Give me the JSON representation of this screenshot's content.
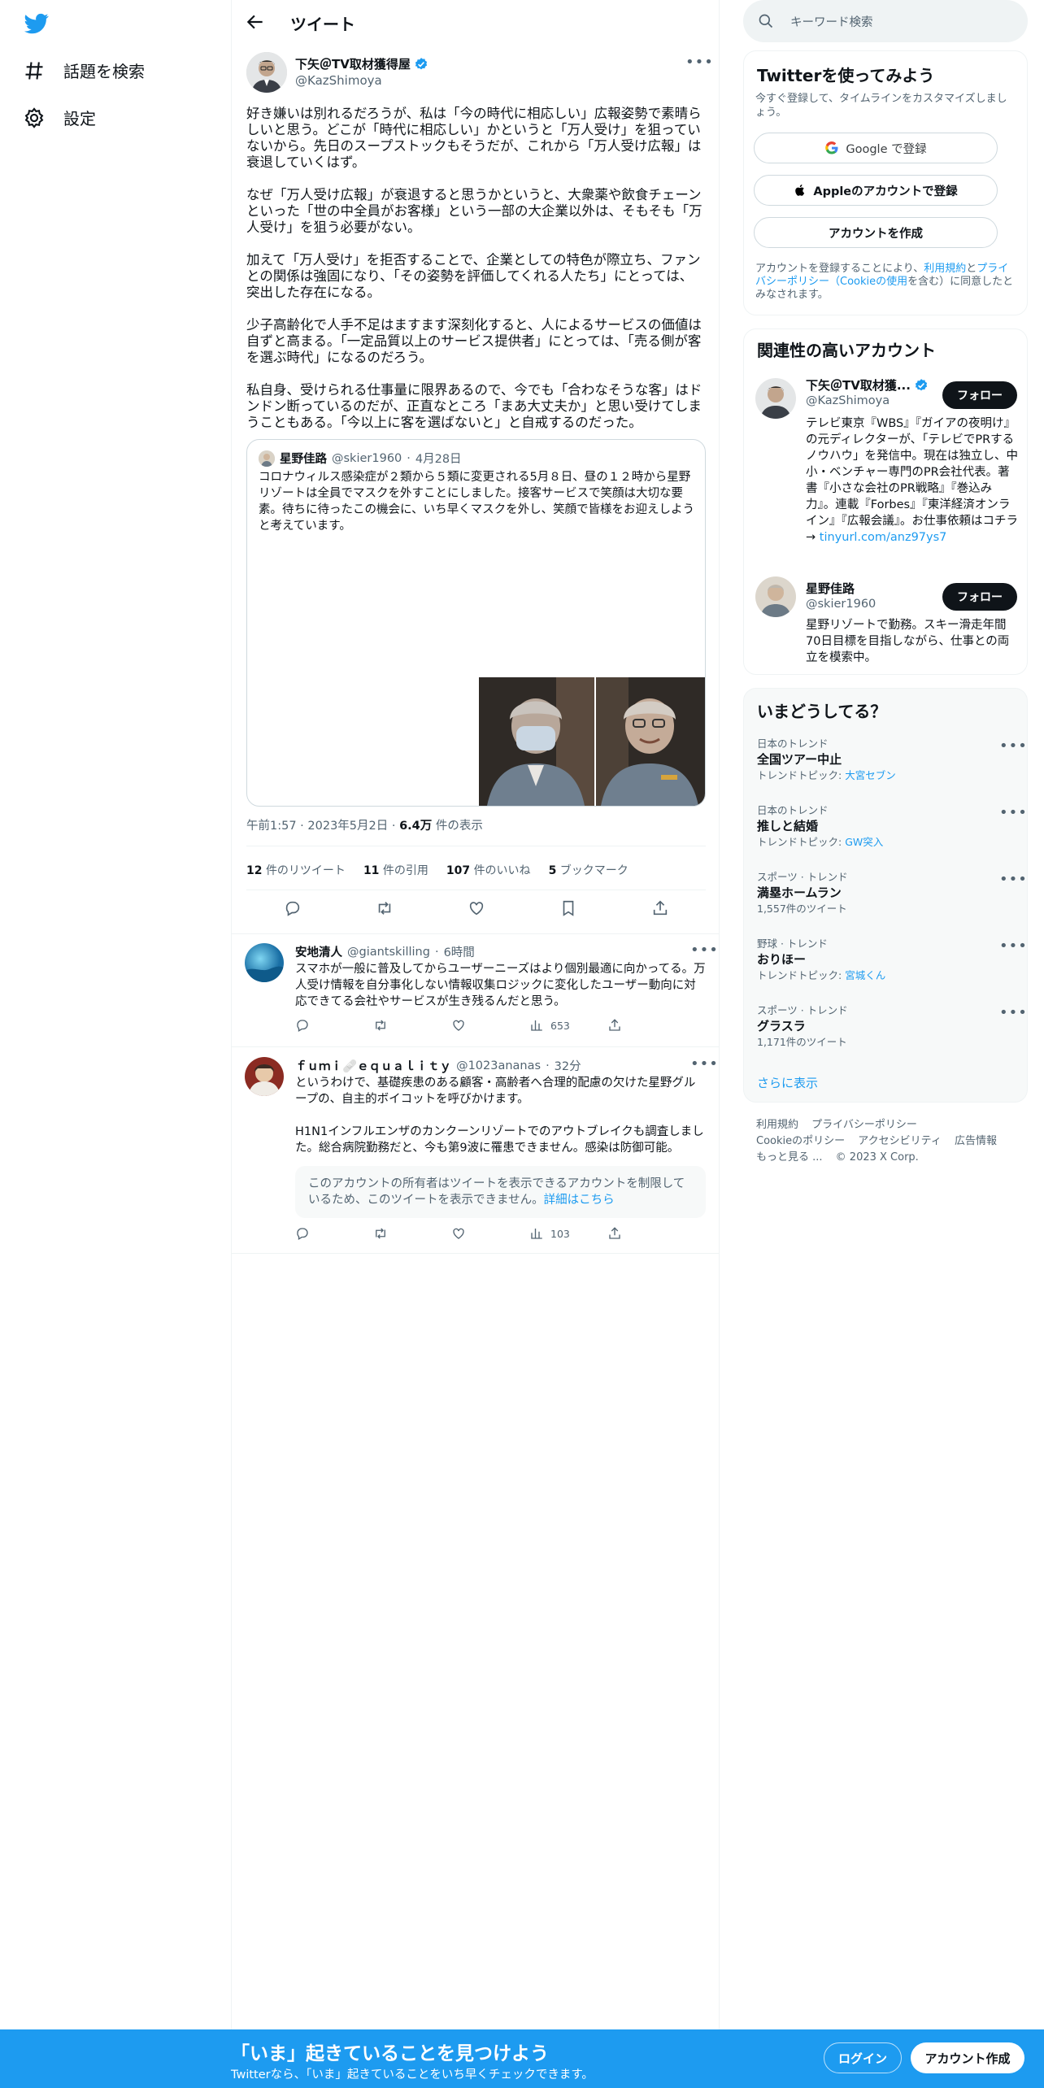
{
  "nav": {
    "items": [
      {
        "label": "話題を検索",
        "icon": "hashtag-icon"
      },
      {
        "label": "設定",
        "icon": "gear-icon"
      }
    ]
  },
  "header": {
    "title": "ツイート"
  },
  "tweet": {
    "author_name": "下矢＠TV取材獲得屋",
    "author_handle": "@KazShimoya",
    "paragraphs": [
      "好き嫌いは別れるだろうが、私は「今の時代に相応しい」広報姿勢で素晴らしいと思う。どこが「時代に相応しい」かというと「万人受け」を狙っていないから。先日のスープストックもそうだが、これから「万人受け広報」は衰退していくはず。",
      "なぜ「万人受け広報」が衰退すると思うかというと、大衆薬や飲食チェーンといった「世の中全員がお客様」という一部の大企業以外は、そもそも「万人受け」を狙う必要がない。",
      "加えて「万人受け」を拒否することで、企業としての特色が際立ち、ファンとの関係は強固になり、「その姿勢を評価してくれる人たち」にとっては、突出した存在になる。",
      "少子高齢化で人手不足はますます深刻化すると、人によるサービスの価値は自ずと高まる。「一定品質以上のサービス提供者」にとっては、「売る側が客を選ぶ時代」になるのだろう。",
      "私自身、受けられる仕事量に限界あるので、今でも「合わなそうな客」はドンドン断っているのだが、正直なところ「まあ大丈夫か」と思い受けてしまうこともある。「今以上に客を選ばないと」と自戒するのだった。"
    ],
    "quote": {
      "name": "星野佳路",
      "handle": "@skier1960",
      "date": "4月28日",
      "text": "コロナウィルス感染症が２類から５類に変更される5月８日、昼の１２時から星野リゾートは全員でマスクを外すことにしました。接客サービスで笑顔は大切な要素。待ちに待ったこの機会に、いち早くマスクを外し、笑顔で皆様をお迎えしようと考えています。"
    },
    "time": "午前1:57",
    "date": "2023年5月2日",
    "views_count": "6.4万",
    "views_label": "件の表示",
    "stats": [
      {
        "count": "12",
        "label": "件のリツイート"
      },
      {
        "count": "11",
        "label": "件の引用"
      },
      {
        "count": "107",
        "label": "件のいいね"
      },
      {
        "count": "5",
        "label": "ブックマーク"
      }
    ]
  },
  "replies": [
    {
      "name": "安地清人",
      "handle": "@giantskilling",
      "time": "6時間",
      "text": "スマホが一般に普及してからユーザーニーズはより個別最適に向かってる。万人受け情報を自分事化しない情報収集ロジックに変化したユーザー動向に対応できてる会社やサービスが生き残るんだと思う。",
      "views": "653"
    },
    {
      "name": "ｆｕｍｉ🩹ｅｑｕａｌｉｔｙ",
      "handle": "@1023ananas",
      "time": "32分",
      "text": "というわけで、基礎疾患のある顧客・高齢者へ合理的配慮の欠けた星野グループの、自主的ボイコットを呼びかけます。",
      "text2": "H1N1インフルエンザのカンクーンリゾートでのアウトブレイクも調査しました。総合病院勤務だと、今も第9波に罹患できません。感染は防御可能。",
      "notice": "このアカウントの所有者はツイートを表示できるアカウントを制限しているため、このツイートを表示できません。",
      "notice_link": "詳細はこちら",
      "views": "103"
    }
  ],
  "sidebar": {
    "search_placeholder": "キーワード検索",
    "signup": {
      "title": "Twitterを使ってみよう",
      "subtitle": "今すぐ登録して、タイムラインをカスタマイズしましょう。",
      "google": "Google で登録",
      "apple": "Appleのアカウントで登録",
      "create": "アカウントを作成",
      "terms_pre": "アカウントを登録することにより、",
      "terms_link1": "利用規約",
      "terms_and": "と",
      "terms_link2": "プライバシーポリシー（Cookieの使用",
      "terms_post": "を含む）に同意したとみなされます。"
    },
    "related": {
      "title": "関連性の高いアカウント",
      "follow_label": "フォロー",
      "accounts": [
        {
          "name": "下矢＠TV取材獲...",
          "handle": "@KazShimoya",
          "bio": "テレビ東京『WBS』『ガイアの夜明け』の元ディレクターが、「テレビでPRするノウハウ」を発信中。現在は独立し、中小・ベンチャー専門のPR会社代表。著書『小さな会社のPR戦略』『巻込み力』。連載『Forbes』『東洋経済オンライン』『広報会議』。お仕事依頼はコチラ→",
          "bio_link": "tinyurl.com/anz97ys7"
        },
        {
          "name": "星野佳路",
          "handle": "@skier1960",
          "bio": "星野リゾートで勤務。スキー滑走年間70日目標を目指しながら、仕事との両立を模索中。"
        }
      ]
    },
    "trends": {
      "title": "いまどうしてる？",
      "items": [
        {
          "category": "日本のトレンド",
          "name": "全国ツアー中止",
          "sub_label": "トレンドトピック: ",
          "sub_link": "大宮セブン"
        },
        {
          "category": "日本のトレンド",
          "name": "推しと結婚",
          "sub_label": "トレンドトピック: ",
          "sub_link": "GW突入"
        },
        {
          "category": "スポーツ · トレンド",
          "name": "満塁ホームラン",
          "sub_label": "1,557件のツイート",
          "sub_link": ""
        },
        {
          "category": "野球 · トレンド",
          "name": "おりほー",
          "sub_label": "トレンドトピック: ",
          "sub_link": "宮城くん"
        },
        {
          "category": "スポーツ · トレンド",
          "name": "グラスラ",
          "sub_label": "1,171件のツイート",
          "sub_link": ""
        }
      ],
      "show_more": "さらに表示"
    },
    "footer": {
      "links": [
        "利用規約",
        "プライバシーポリシー",
        "Cookieのポリシー",
        "アクセシビリティ",
        "広告情報",
        "もっと見る ..."
      ],
      "copyright": "© 2023 X Corp."
    }
  },
  "bottombar": {
    "title": "「いま」起きていることを見つけよう",
    "subtitle": "Twitterなら、「いま」起きていることをいち早くチェックできます。",
    "login": "ログイン",
    "signup": "アカウント作成"
  },
  "colors": {
    "accent": "#1d9bf0",
    "text": "#0f1419",
    "muted": "#536471",
    "border": "#eff3f4"
  }
}
